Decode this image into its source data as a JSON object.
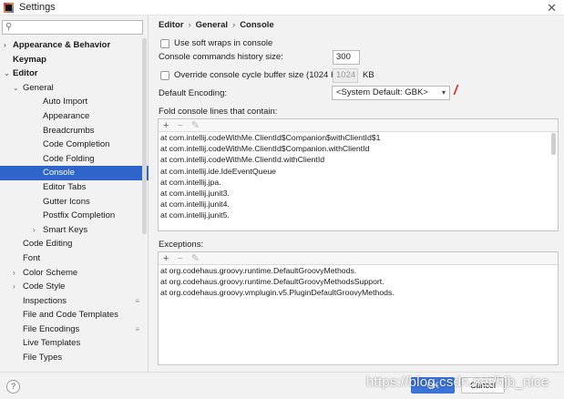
{
  "window": {
    "title": "Settings",
    "close_glyph": "✕"
  },
  "sidebar": {
    "search_placeholder": "",
    "items": [
      {
        "label": "Appearance & Behavior",
        "level": 0,
        "arrow": "›",
        "bold": true
      },
      {
        "label": "Keymap",
        "level": 0,
        "arrow": "",
        "bold": true
      },
      {
        "label": "Editor",
        "level": 0,
        "arrow": "⌄",
        "bold": true
      },
      {
        "label": "General",
        "level": 1,
        "arrow": "⌄",
        "bold": false
      },
      {
        "label": "Auto Import",
        "level": 2,
        "arrow": "",
        "bold": false
      },
      {
        "label": "Appearance",
        "level": 2,
        "arrow": "",
        "bold": false
      },
      {
        "label": "Breadcrumbs",
        "level": 2,
        "arrow": "",
        "bold": false
      },
      {
        "label": "Code Completion",
        "level": 2,
        "arrow": "",
        "bold": false
      },
      {
        "label": "Code Folding",
        "level": 2,
        "arrow": "",
        "bold": false
      },
      {
        "label": "Console",
        "level": 2,
        "arrow": "",
        "bold": false,
        "selected": true
      },
      {
        "label": "Editor Tabs",
        "level": 2,
        "arrow": "",
        "bold": false
      },
      {
        "label": "Gutter Icons",
        "level": 2,
        "arrow": "",
        "bold": false
      },
      {
        "label": "Postfix Completion",
        "level": 2,
        "arrow": "",
        "bold": false
      },
      {
        "label": "Smart Keys",
        "level": 2,
        "arrow": "›",
        "bold": false
      },
      {
        "label": "Code Editing",
        "level": 1,
        "arrow": "",
        "bold": false
      },
      {
        "label": "Font",
        "level": 1,
        "arrow": "",
        "bold": false
      },
      {
        "label": "Color Scheme",
        "level": 1,
        "arrow": "›",
        "bold": false
      },
      {
        "label": "Code Style",
        "level": 1,
        "arrow": "›",
        "bold": false
      },
      {
        "label": "Inspections",
        "level": 1,
        "arrow": "",
        "bold": false,
        "badge": "≡"
      },
      {
        "label": "File and Code Templates",
        "level": 1,
        "arrow": "",
        "bold": false
      },
      {
        "label": "File Encodings",
        "level": 1,
        "arrow": "",
        "bold": false,
        "badge": "≡"
      },
      {
        "label": "Live Templates",
        "level": 1,
        "arrow": "",
        "bold": false
      },
      {
        "label": "File Types",
        "level": 1,
        "arrow": "",
        "bold": false
      }
    ]
  },
  "breadcrumb": {
    "parts": [
      "Editor",
      "General",
      "Console"
    ],
    "separator": "›"
  },
  "settings": {
    "soft_wraps_label": "Use soft wraps in console",
    "history_size_label": "Console commands history size:",
    "history_size_value": "300",
    "override_buffer_label": "Override console cycle buffer size (1024 KB)",
    "buffer_value": "1024",
    "buffer_unit": "KB",
    "encoding_label": "Default Encoding:",
    "encoding_value": "<System Default: GBK>",
    "encoding_caret": "▾",
    "annotation_mark": "/"
  },
  "fold_section": {
    "label": "Fold console lines that contain:",
    "toolbar": {
      "add": "+",
      "remove": "−",
      "edit": "✎"
    },
    "lines": [
      "at com.intellij.codeWithMe.ClientId$Companion$withClientId$1",
      "at com.intellij.codeWithMe.ClientId$Companion.withClientId",
      "at com.intellij.codeWithMe.ClientId.withClientId",
      "at com.intellij.ide.IdeEventQueue",
      "at com.intellij.jpa.",
      "at com.intellij.junit3.",
      "at com.intellij.junit4.",
      "at com.intellij.junit5."
    ]
  },
  "exceptions_section": {
    "label": "Exceptions:",
    "toolbar": {
      "add": "+",
      "remove": "−",
      "edit": "✎"
    },
    "lines": [
      "at org.codehaus.groovy.runtime.DefaultGroovyMethods.",
      "at org.codehaus.groovy.runtime.DefaultGroovyMethodsSupport.",
      "at org.codehaus.groovy.vmplugin.v5.PluginDefaultGroovyMethods."
    ]
  },
  "footer": {
    "help_label": "?",
    "ok_label": "OK",
    "cancel_label": "Cancel",
    "watermark": "https://blog.csdn.net/hjb_nice"
  },
  "colors": {
    "selection": "#2f65ca",
    "primary_button": "#3b73d8",
    "annotation_red": "#e0262a"
  }
}
